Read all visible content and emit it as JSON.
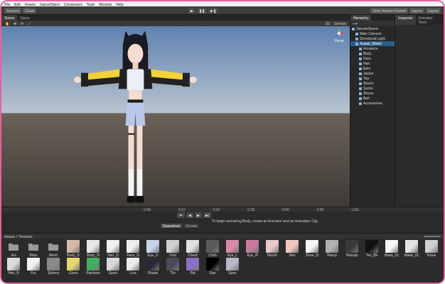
{
  "menu": [
    "File",
    "Edit",
    "Assets",
    "GameObject",
    "Component",
    "Tools",
    "Window",
    "Help"
  ],
  "toolbar": {
    "left": [
      "Account",
      "Cloud"
    ],
    "controls": [
      "▶",
      "❚❚",
      "▶❚"
    ],
    "right": [
      "Unity Version Control",
      "Layers",
      "Layout"
    ]
  },
  "scene_tabs": [
    {
      "label": "Scene",
      "selected": true
    },
    {
      "label": "Game",
      "selected": false
    }
  ],
  "scene_toolbar": {
    "tools": [
      "✋",
      "✥",
      "⟳",
      "⤢"
    ],
    "right": [
      "2D",
      "Gizmos"
    ]
  },
  "gizmo": {
    "label": "Persp"
  },
  "hierarchy": {
    "title": "Hierarchy",
    "add": "+ ▾",
    "items": [
      {
        "label": "SampleScene",
        "depth": 0,
        "selected": false
      },
      {
        "label": "Main Camera",
        "depth": 1,
        "selected": false
      },
      {
        "label": "Directional Light",
        "depth": 1,
        "selected": false
      },
      {
        "label": "Avatar_Model",
        "depth": 1,
        "selected": true
      },
      {
        "label": "Armature",
        "depth": 2,
        "selected": false
      },
      {
        "label": "Body",
        "depth": 2,
        "selected": false
      },
      {
        "label": "Face",
        "depth": 2,
        "selected": false
      },
      {
        "label": "Hair",
        "depth": 2,
        "selected": false
      },
      {
        "label": "Ears",
        "depth": 2,
        "selected": false
      },
      {
        "label": "Jacket",
        "depth": 2,
        "selected": false
      },
      {
        "label": "Top",
        "depth": 2,
        "selected": false
      },
      {
        "label": "Shorts",
        "depth": 2,
        "selected": false
      },
      {
        "label": "Socks",
        "depth": 2,
        "selected": false
      },
      {
        "label": "Shoes",
        "depth": 2,
        "selected": false
      },
      {
        "label": "Belt",
        "depth": 2,
        "selected": false
      },
      {
        "label": "Accessories",
        "depth": 2,
        "selected": false
      }
    ]
  },
  "inspector_tabs": [
    {
      "label": "Inspector",
      "selected": true
    },
    {
      "label": "Animator Tools",
      "selected": false
    }
  ],
  "timeline": {
    "controls": [
      "⏮",
      "◀",
      "▶",
      "▶|"
    ],
    "ticks": [
      "0:00",
      "0:10",
      "0:20",
      "0:30",
      "0:40",
      "0:50",
      "1:00"
    ],
    "message": "To begin animating Body, create an Animator and an Animation Clip.",
    "tabs": [
      {
        "label": "Dopesheet",
        "selected": true
      },
      {
        "label": "Curves",
        "selected": false
      }
    ]
  },
  "project": {
    "breadcrumb": "Assets > Textures",
    "assets": [
      {
        "name": "Ani",
        "kind": "folder",
        "color": "#9a9a9a"
      },
      {
        "name": "Mats",
        "kind": "folder",
        "color": "#9a9a9a"
      },
      {
        "name": "Mesh",
        "kind": "folder",
        "color": "#9a9a9a"
      },
      {
        "name": "Body_D",
        "kind": "texture",
        "color": "#d8b8a8"
      },
      {
        "name": "Body_N",
        "kind": "texture",
        "color": "#e8e8e8"
      },
      {
        "name": "Hair_D",
        "kind": "texture",
        "color": "#f0f0f0"
      },
      {
        "name": "Face_D",
        "kind": "texture",
        "color": "#eeeeee"
      },
      {
        "name": "Eye_D",
        "kind": "texture",
        "color": "#c8d4ec"
      },
      {
        "name": "Grid",
        "kind": "texture",
        "color": "#d0d0d0"
      },
      {
        "name": "Check",
        "kind": "texture",
        "color": "#e0e0e0"
      },
      {
        "name": "Cloth",
        "kind": "texture",
        "color": "#5a5a5a"
      },
      {
        "name": "Eye_L",
        "kind": "texture",
        "color": "#d88aa8"
      },
      {
        "name": "Eye_R",
        "kind": "texture",
        "color": "#c87aa0"
      },
      {
        "name": "Mouth",
        "kind": "texture",
        "color": "#e8c8c8"
      },
      {
        "name": "Skin",
        "kind": "texture",
        "color": "#f0c8c0"
      },
      {
        "name": "Shoe_D",
        "kind": "texture",
        "color": "#f4f4f4"
      },
      {
        "name": "Ramp",
        "kind": "texture",
        "color": "#b0b0b0"
      },
      {
        "name": "Matcap",
        "kind": "texture",
        "color": "#3a3a3a"
      },
      {
        "name": "Tex_Bk",
        "kind": "texture",
        "color": "#111111"
      },
      {
        "name": "Mask_01",
        "kind": "texture",
        "color": "#f8f8f8"
      },
      {
        "name": "Mask_02",
        "kind": "texture",
        "color": "#e4e4e4"
      },
      {
        "name": "Noise",
        "kind": "texture",
        "color": "#cfcfcf"
      },
      {
        "name": "Hair_N",
        "kind": "texture",
        "color": "#dcdcdc"
      },
      {
        "name": "Fur",
        "kind": "texture",
        "color": "#f2f2f2"
      },
      {
        "name": "Sphere",
        "kind": "texture",
        "color": "#8a8a8a"
      },
      {
        "name": "Gloss",
        "kind": "texture",
        "color": "#e8d870"
      },
      {
        "name": "Rainbow",
        "kind": "texture",
        "color": "#40b060"
      },
      {
        "name": "Spots",
        "kind": "texture",
        "color": "#d8d8d8"
      },
      {
        "name": "Line",
        "kind": "texture",
        "color": "#ececec"
      },
      {
        "name": "Shade",
        "kind": "texture",
        "color": "#2a2a3a"
      },
      {
        "name": "Tile",
        "kind": "texture",
        "color": "#4a4a5a"
      },
      {
        "name": "Pal",
        "kind": "texture",
        "color": "#8a70c8"
      },
      {
        "name": "Star",
        "kind": "texture",
        "color": "#000000"
      },
      {
        "name": "Spec",
        "kind": "texture",
        "color": "#b8b8c8"
      }
    ]
  }
}
